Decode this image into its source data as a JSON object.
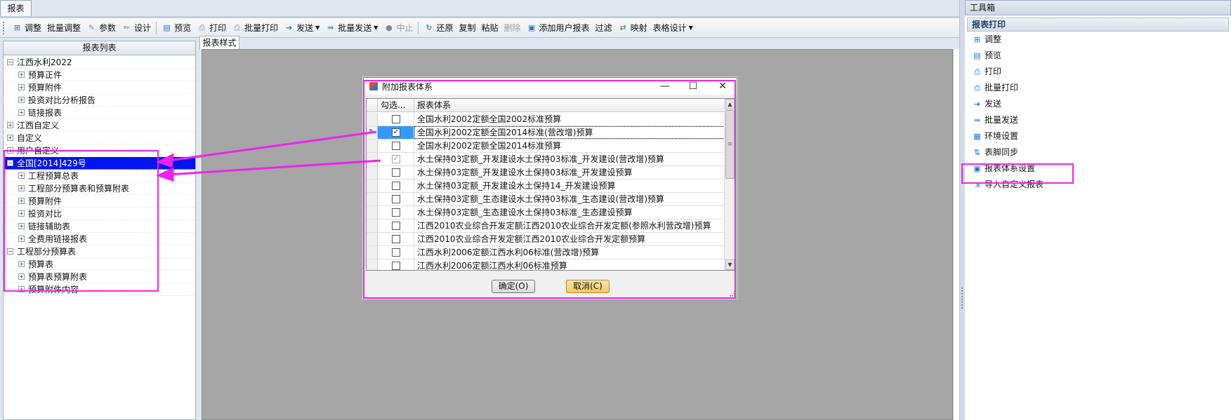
{
  "doc_tab": "报表",
  "toolbar": [
    {
      "name": "adjust-button",
      "icon": "adjust-icon",
      "label": "调整",
      "glyph": "⊞",
      "color": "blue"
    },
    {
      "name": "batch-adjust-button",
      "icon": "",
      "label": "批量调整",
      "glyph": "",
      "color": ""
    },
    {
      "name": "params-button",
      "icon": "params-icon",
      "label": "参数",
      "glyph": "✎",
      "color": "gray"
    },
    {
      "name": "design-button",
      "icon": "pencil-icon",
      "label": "设计",
      "glyph": "✏",
      "color": "gray"
    },
    {
      "sep": true
    },
    {
      "name": "preview-button",
      "icon": "preview-icon",
      "label": "预览",
      "glyph": "▤",
      "color": "blue"
    },
    {
      "name": "print-button",
      "icon": "printer-icon",
      "label": "打印",
      "glyph": "⎙",
      "color": "gray"
    },
    {
      "name": "batch-print-button",
      "icon": "printer-icon",
      "label": "批量打印",
      "glyph": "⎙",
      "color": "gray"
    },
    {
      "name": "send-button",
      "icon": "arrow-right-icon",
      "label": "发送",
      "glyph": "➔",
      "color": "blue",
      "dropdown": true
    },
    {
      "name": "batch-send-button",
      "icon": "double-arrow-icon",
      "label": "批量发送",
      "glyph": "⇛",
      "color": "blue",
      "dropdown": true
    },
    {
      "name": "stop-button",
      "icon": "stop-icon",
      "label": "中止",
      "glyph": "●",
      "color": "gray",
      "disabled": true
    },
    {
      "sep": true
    },
    {
      "name": "restore-button",
      "icon": "restore-icon",
      "label": "还原",
      "glyph": "↻",
      "color": "blue"
    },
    {
      "name": "copy-button",
      "icon": "",
      "label": "复制",
      "glyph": "",
      "color": ""
    },
    {
      "name": "paste-button",
      "icon": "",
      "label": "粘贴",
      "glyph": "",
      "color": ""
    },
    {
      "name": "delete-button",
      "icon": "",
      "label": "删除",
      "glyph": "",
      "color": "",
      "disabled": true
    },
    {
      "name": "add-user-report-button",
      "icon": "add-report-icon",
      "label": "添加用户报表",
      "glyph": "▣",
      "color": "blue"
    },
    {
      "name": "filter-button",
      "icon": "",
      "label": "过滤",
      "glyph": "",
      "color": ""
    },
    {
      "name": "map-button",
      "icon": "map-icon",
      "label": "映射",
      "glyph": "⇄",
      "color": "green"
    },
    {
      "name": "table-design-button",
      "icon": "",
      "label": "表格设计",
      "glyph": "",
      "color": "",
      "dropdown": true
    }
  ],
  "left_panel": {
    "header": "报表列表",
    "tree": [
      {
        "label": "江西水利2022",
        "level": 0,
        "expanded": true
      },
      {
        "label": "预算正件",
        "level": 1
      },
      {
        "label": "预算附件",
        "level": 1
      },
      {
        "label": "投资对比分析报告",
        "level": 1
      },
      {
        "label": "链接报表",
        "level": 1
      },
      {
        "label": "江西自定义",
        "level": 0
      },
      {
        "label": "自定义",
        "level": 0
      },
      {
        "label": "用户自定义",
        "level": 0
      },
      {
        "label": "全国[2014]429号",
        "level": 0,
        "expanded": true,
        "selected": true
      },
      {
        "label": "工程预算总表",
        "level": 1
      },
      {
        "label": "工程部分预算表和预算附表",
        "level": 1
      },
      {
        "label": "预算附件",
        "level": 1
      },
      {
        "label": "投资对比",
        "level": 1
      },
      {
        "label": "链接辅助表",
        "level": 1
      },
      {
        "label": "全费用链接报表",
        "level": 1
      },
      {
        "label": "工程部分预算表",
        "level": 0,
        "expanded": true
      },
      {
        "label": "预算表",
        "level": 1
      },
      {
        "label": "预算表预算附表",
        "level": 1
      },
      {
        "label": "预算附件内容",
        "level": 1
      }
    ]
  },
  "style_tab": "报表样式",
  "dialog": {
    "title": "附加报表体系",
    "columns": {
      "check": "勾选...",
      "name": "报表体系"
    },
    "rows": [
      {
        "name": "全国水利2002定额全国2002标准预算",
        "checked": false
      },
      {
        "name": "全国水利2002定额全国2014标准(营改增)预算",
        "checked": true,
        "current": true
      },
      {
        "name": "全国水利2002定额全国2014标准预算",
        "checked": false
      },
      {
        "name": "水土保持03定额_开发建设水土保持03标准_开发建设(营改增)预算",
        "checked": true,
        "faded": true
      },
      {
        "name": "水土保持03定额_开发建设水土保持03标准_开发建设预算",
        "checked": false
      },
      {
        "name": "水土保持03定额_开发建设水土保持14_开发建设预算",
        "checked": false
      },
      {
        "name": "水土保持03定额_生态建设水土保持03标准_生态建设(营改增)预算",
        "checked": false
      },
      {
        "name": "水土保持03定额_生态建设水土保持03标准_生态建设预算",
        "checked": false
      },
      {
        "name": "江西2010农业综合开发定额江西2010农业综合开发定额(参照水利营改增)预算",
        "checked": false
      },
      {
        "name": "江西2010农业综合开发定额江西2010农业综合开发定额预算",
        "checked": false
      },
      {
        "name": "江西水利2006定额江西水利06标准(营改增)预算",
        "checked": false
      },
      {
        "name": "江西水利2006定额江西水利06标准预算",
        "checked": false
      }
    ],
    "ok_label": "确定(O)",
    "cancel_label": "取消(C)"
  },
  "toolbox": {
    "title": "工具箱",
    "section": "报表打印",
    "items": [
      {
        "name": "tool-adjust",
        "icon": "adjust-icon",
        "label": "调整",
        "glyph": "⊞"
      },
      {
        "name": "tool-preview",
        "icon": "preview-icon",
        "label": "预览",
        "glyph": "▤"
      },
      {
        "name": "tool-print",
        "icon": "printer-icon",
        "label": "打印",
        "glyph": "⎙"
      },
      {
        "name": "tool-batch-print",
        "icon": "printer-icon",
        "label": "批量打印",
        "glyph": "⎙"
      },
      {
        "name": "tool-send",
        "icon": "arrow-right-icon",
        "label": "发送",
        "glyph": "➔"
      },
      {
        "name": "tool-batch-send",
        "icon": "double-arrow-icon",
        "label": "批量发送",
        "glyph": "⇛"
      },
      {
        "name": "tool-env-settings",
        "icon": "monitor-icon",
        "label": "环境设置",
        "glyph": "▦"
      },
      {
        "name": "tool-footer-sync",
        "icon": "sync-icon",
        "label": "表脚同步",
        "glyph": "⇅"
      },
      {
        "name": "tool-report-system-settings",
        "icon": "report-system-icon",
        "label": "报表体系设置",
        "glyph": "▣"
      },
      {
        "name": "tool-import-custom-report",
        "icon": "import-icon",
        "label": "导入自定义报表",
        "glyph": "⇲"
      }
    ]
  },
  "colors": {
    "highlight": "#ee22ee",
    "selection": "#0014ee",
    "checkbox_active": "#3399ff"
  }
}
